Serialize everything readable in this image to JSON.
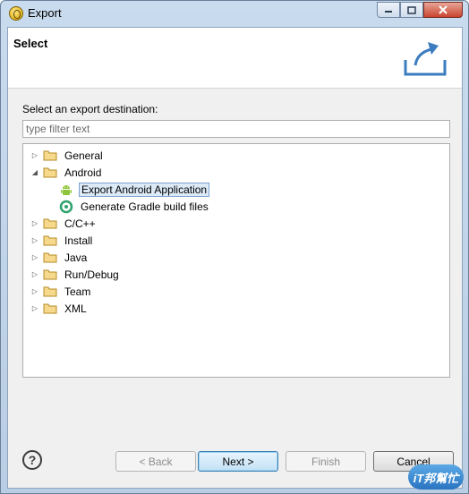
{
  "window": {
    "title": "Export",
    "controls": [
      "minimize-icon",
      "maximize-icon",
      "close-icon"
    ]
  },
  "banner": {
    "title": "Select",
    "icon": "export-icon"
  },
  "page": {
    "description": "Select an export destination:",
    "filter_placeholder": "type filter text"
  },
  "tree": {
    "nodes": [
      {
        "label": "General",
        "expanded": false,
        "icon": "folder-icon"
      },
      {
        "label": "Android",
        "expanded": true,
        "icon": "folder-icon",
        "children": [
          {
            "label": "Export Android Application",
            "icon": "android-icon",
            "selected": true
          },
          {
            "label": "Generate Gradle build files",
            "icon": "gradle-icon",
            "selected": false
          }
        ]
      },
      {
        "label": "C/C++",
        "expanded": false,
        "icon": "folder-icon"
      },
      {
        "label": "Install",
        "expanded": false,
        "icon": "folder-icon"
      },
      {
        "label": "Java",
        "expanded": false,
        "icon": "folder-icon"
      },
      {
        "label": "Run/Debug",
        "expanded": false,
        "icon": "folder-icon"
      },
      {
        "label": "Team",
        "expanded": false,
        "icon": "folder-icon"
      },
      {
        "label": "XML",
        "expanded": false,
        "icon": "folder-icon"
      }
    ]
  },
  "buttons": {
    "help_label": "?",
    "back_label": "< Back",
    "next_label": "Next >",
    "finish_label": "Finish",
    "cancel_label": "Cancel"
  },
  "watermark": {
    "text": "iT邦幫忙"
  },
  "colors": {
    "selection_bg": "#dceaf7",
    "selection_border": "#7da2ce",
    "titlebar": "#c9dbee"
  }
}
